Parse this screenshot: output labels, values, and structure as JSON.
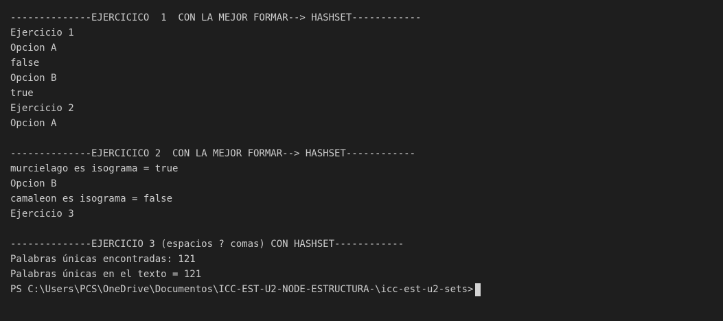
{
  "terminal": {
    "lines": [
      "--------------EJERCICICO  1  CON LA MEJOR FORMAR--> HASHSET------------",
      "Ejercicio 1",
      "Opcion A",
      "false",
      "Opcion B",
      "true",
      "Ejercicio 2",
      "Opcion A",
      "",
      "--------------EJERCICICO 2  CON LA MEJOR FORMAR--> HASHSET------------",
      "murcielago es isograma = true",
      "Opcion B",
      "camaleon es isograma = false",
      "Ejercicio 3",
      "",
      "--------------EJERCICIO 3 (espacios ? comas) CON HASHSET------------",
      "Palabras únicas encontradas: 121",
      "Palabras únicas en el texto = 121"
    ],
    "prompt": "PS C:\\Users\\PCS\\OneDrive\\Documentos\\ICC-EST-U2-NODE-ESTRUCTURA-\\icc-est-u2-sets>"
  },
  "colors": {
    "background": "#1e1e1e",
    "text": "#cccccc",
    "cursor": "#d4d4d4"
  }
}
